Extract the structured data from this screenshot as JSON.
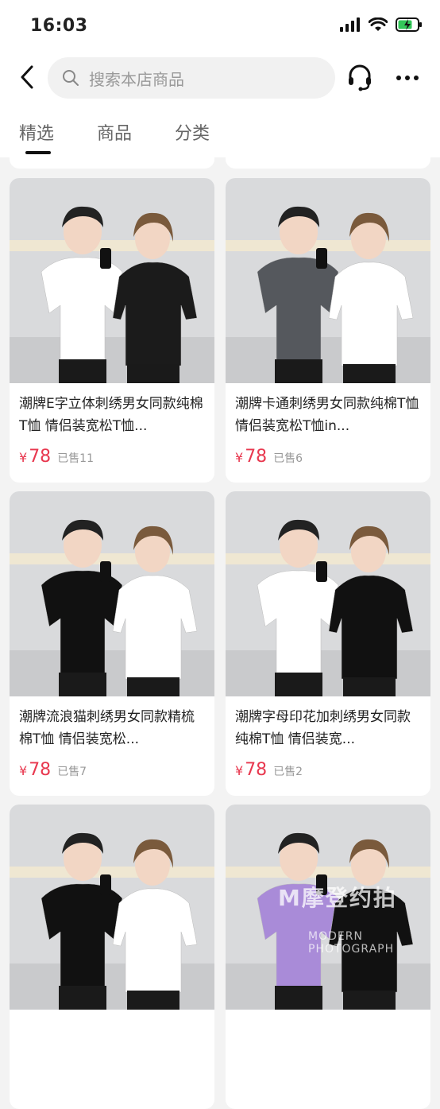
{
  "status": {
    "time": "16:03"
  },
  "search": {
    "placeholder": "搜索本店商品"
  },
  "tabs": [
    {
      "label": "精选",
      "active": true
    },
    {
      "label": "商品",
      "active": false
    },
    {
      "label": "分类",
      "active": false
    }
  ],
  "products": [
    {
      "title": "潮牌E字立体刺绣男女同款纯棉T恤 情侣装宽松T恤...",
      "currency": "¥",
      "price": "78",
      "sold": "已售11",
      "shirt_colors": [
        "#ffffff",
        "#1b1b1b"
      ]
    },
    {
      "title": "潮牌卡通刺绣男女同款纯棉T恤 情侣装宽松T恤in...",
      "currency": "¥",
      "price": "78",
      "sold": "已售6",
      "shirt_colors": [
        "#55585d",
        "#ffffff"
      ]
    },
    {
      "title": "潮牌流浪猫刺绣男女同款精梳棉T恤 情侣装宽松...",
      "currency": "¥",
      "price": "78",
      "sold": "已售7",
      "shirt_colors": [
        "#111111",
        "#ffffff"
      ]
    },
    {
      "title": "潮牌字母印花加刺绣男女同款纯棉T恤 情侣装宽...",
      "currency": "¥",
      "price": "78",
      "sold": "已售2",
      "shirt_colors": [
        "#ffffff",
        "#111111"
      ]
    },
    {
      "title": "",
      "currency": "",
      "price": "",
      "sold": "",
      "shirt_colors": [
        "#111111",
        "#ffffff"
      ]
    },
    {
      "title": "",
      "currency": "",
      "price": "",
      "sold": "",
      "shirt_colors": [
        "#a98bd8",
        "#111111"
      ]
    }
  ],
  "watermark": {
    "main": "M摩登约拍",
    "sub": "MODERN PHOTOGRAPH"
  },
  "colors": {
    "price": "#e8384f",
    "background": "#f3f3f3"
  }
}
